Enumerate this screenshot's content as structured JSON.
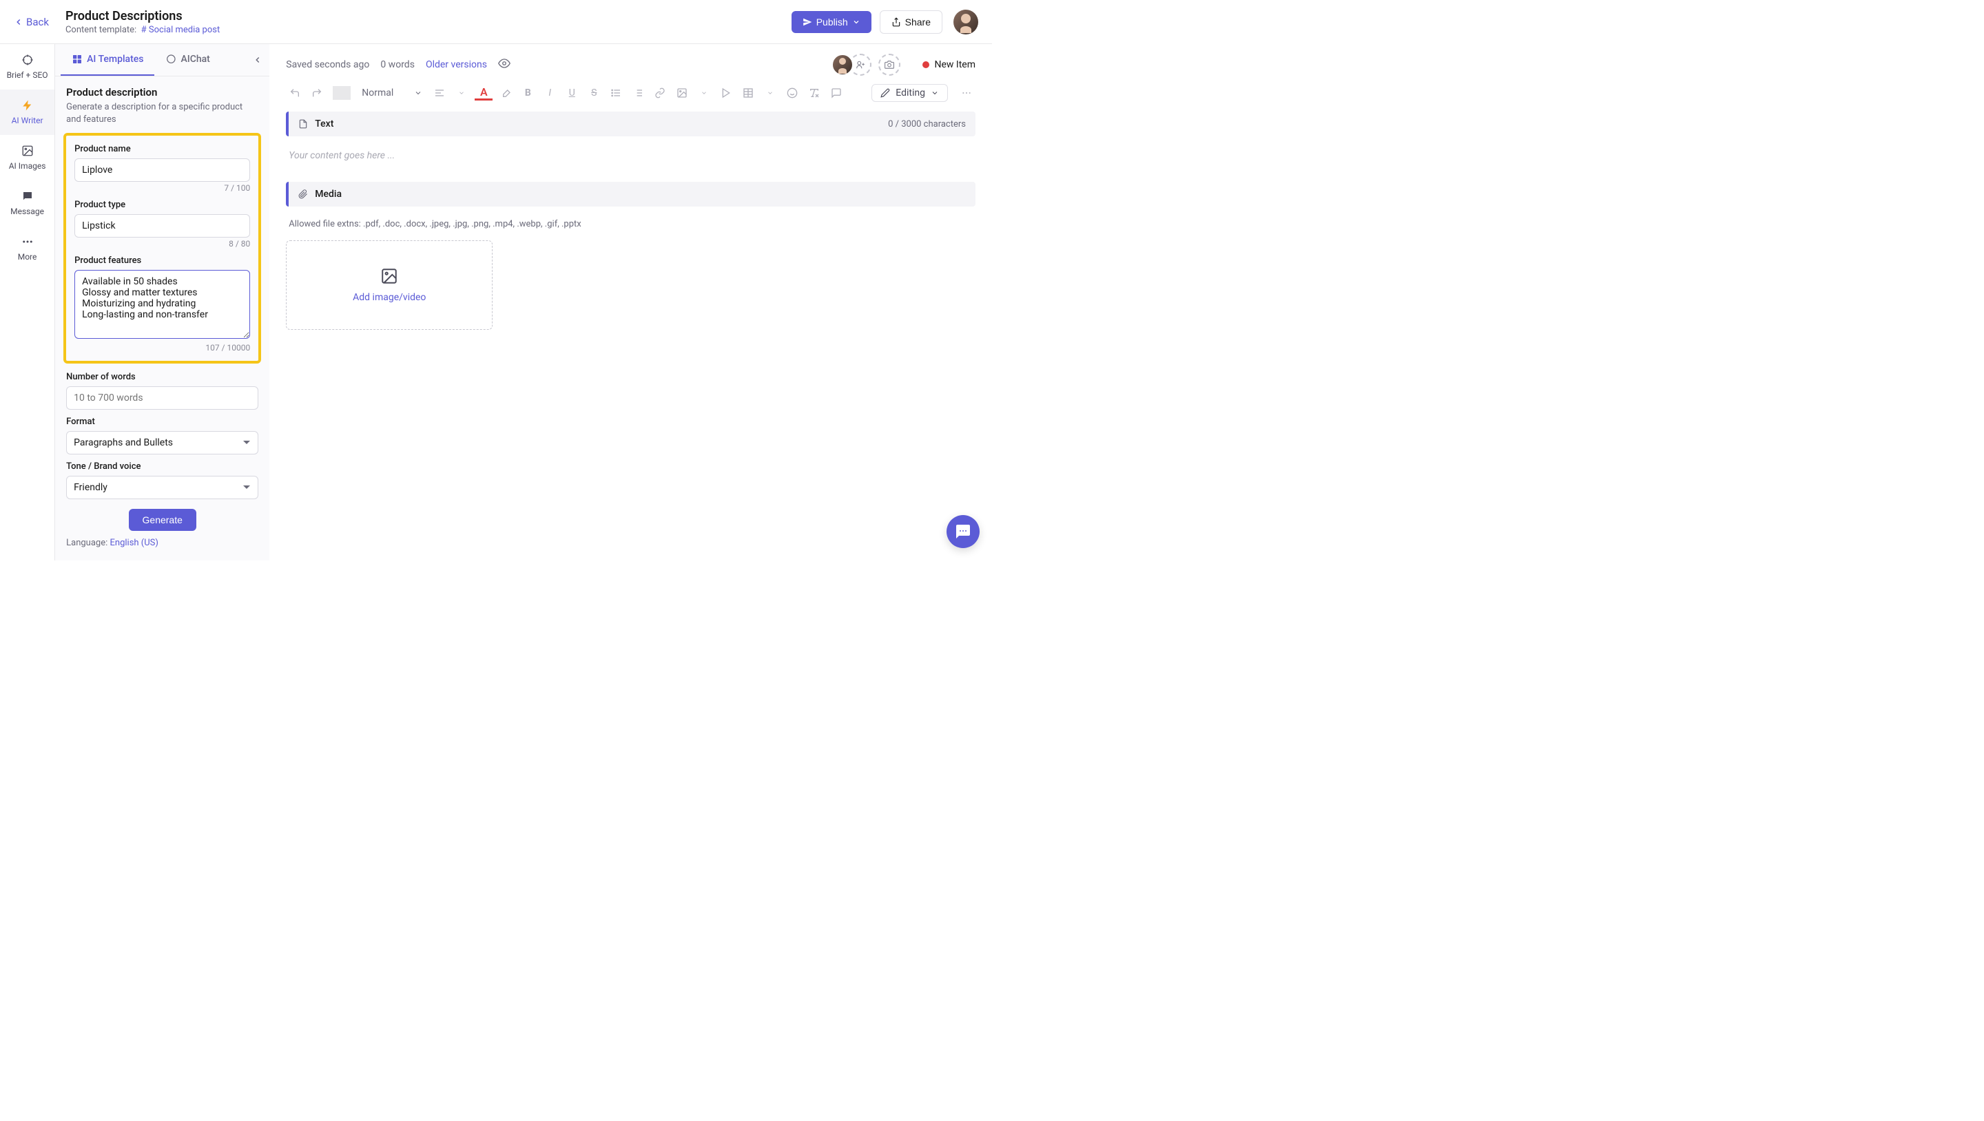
{
  "header": {
    "back": "Back",
    "title": "Product Descriptions",
    "subtitle_label": "Content template:",
    "subtitle_value": "Social media post",
    "publish": "Publish",
    "share": "Share"
  },
  "sideNav": {
    "brief": "Brief + SEO",
    "writer": "AI Writer",
    "images": "AI Images",
    "message": "Message",
    "more": "More"
  },
  "aiPanel": {
    "tabs": {
      "templates": "AI Templates",
      "chat": "AIChat"
    },
    "title": "Product description",
    "desc": "Generate a description for a specific product and features",
    "labels": {
      "productName": "Product name",
      "productType": "Product type",
      "productFeatures": "Product features",
      "numWords": "Number of words",
      "format": "Format",
      "tone": "Tone / Brand voice"
    },
    "values": {
      "productName": "Liplove",
      "productType": "Lipstick",
      "productFeatures": "Available in 50 shades\nGlossy and matter textures\nMoisturizing and hydrating\nLong-lasting and non-transfer",
      "numWords": "",
      "format": "Paragraphs and Bullets",
      "tone": "Friendly"
    },
    "placeholders": {
      "numWords": "10 to 700 words"
    },
    "counts": {
      "productName": "7 / 100",
      "productType": "8 / 80",
      "productFeatures": "107 / 10000"
    },
    "generate": "Generate",
    "langLabel": "Language:",
    "langValue": "English (US)"
  },
  "editor": {
    "saved": "Saved seconds ago",
    "words": "0 words",
    "older": "Older versions",
    "status": "New Item",
    "normal": "Normal",
    "editing": "Editing",
    "textBlock": "Text",
    "textChars": "0 / 3000 characters",
    "placeholder": "Your content goes here ...",
    "mediaBlock": "Media",
    "allowed": "Allowed file extns: .pdf, .doc, .docx, .jpeg, .jpg, .png, .mp4, .webp, .gif, .pptx",
    "addMedia": "Add image/video"
  }
}
